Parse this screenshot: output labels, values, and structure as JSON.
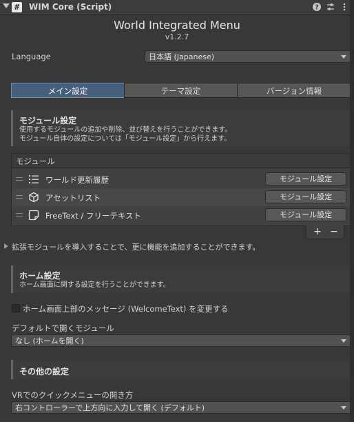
{
  "header": {
    "title": "WIM Core (Script)",
    "script_icon_glyph": "#",
    "icons": [
      "help-icon",
      "presets-icon",
      "more-menu-icon"
    ]
  },
  "title": "World Integrated Menu",
  "version": "v1.2.7",
  "language": {
    "label": "Language",
    "selected": "日本語 (Japanese)"
  },
  "tabs": [
    {
      "label": "メイン設定",
      "active": true
    },
    {
      "label": "テーマ設定",
      "active": false
    },
    {
      "label": "バージョン情報",
      "active": false
    }
  ],
  "module_section": {
    "title": "モジュール設定",
    "desc_line1": "使用するモジュールの追加や削除、並び替えを行うことができます。",
    "desc_line2": "モジュール自体の設定については「モジュール設定」から行えます。"
  },
  "module_list": {
    "header": "モジュール",
    "items": [
      {
        "label": "ワールド更新履歴",
        "icon": "list-icon",
        "button": "モジュール設定"
      },
      {
        "label": "アセットリスト",
        "icon": "cube-icon",
        "button": "モジュール設定"
      },
      {
        "label": "FreeText / フリーテキスト",
        "icon": "note-icon",
        "button": "モジュール設定"
      }
    ],
    "add_label": "+",
    "remove_label": "−"
  },
  "extension_foldout": "拡張モジュールを導入することで、更に機能を追加することができます。",
  "home_section": {
    "title": "ホーム設定",
    "desc": "ホーム画面に関する設定を行うことができます。"
  },
  "welcome_toggle": {
    "label": "ホーム画面上部のメッセージ (WelcomeText) を変更する",
    "checked": false
  },
  "default_module": {
    "label": "デフォルトで開くモジュール",
    "selected": "なし (ホームを開く)"
  },
  "other_section": {
    "title": "その他の設定"
  },
  "vr_quickmenu": {
    "label": "VRでのクイックメニューの開き方",
    "selected": "右コントローラーで上方向に入力して開く (デフォルト)"
  }
}
